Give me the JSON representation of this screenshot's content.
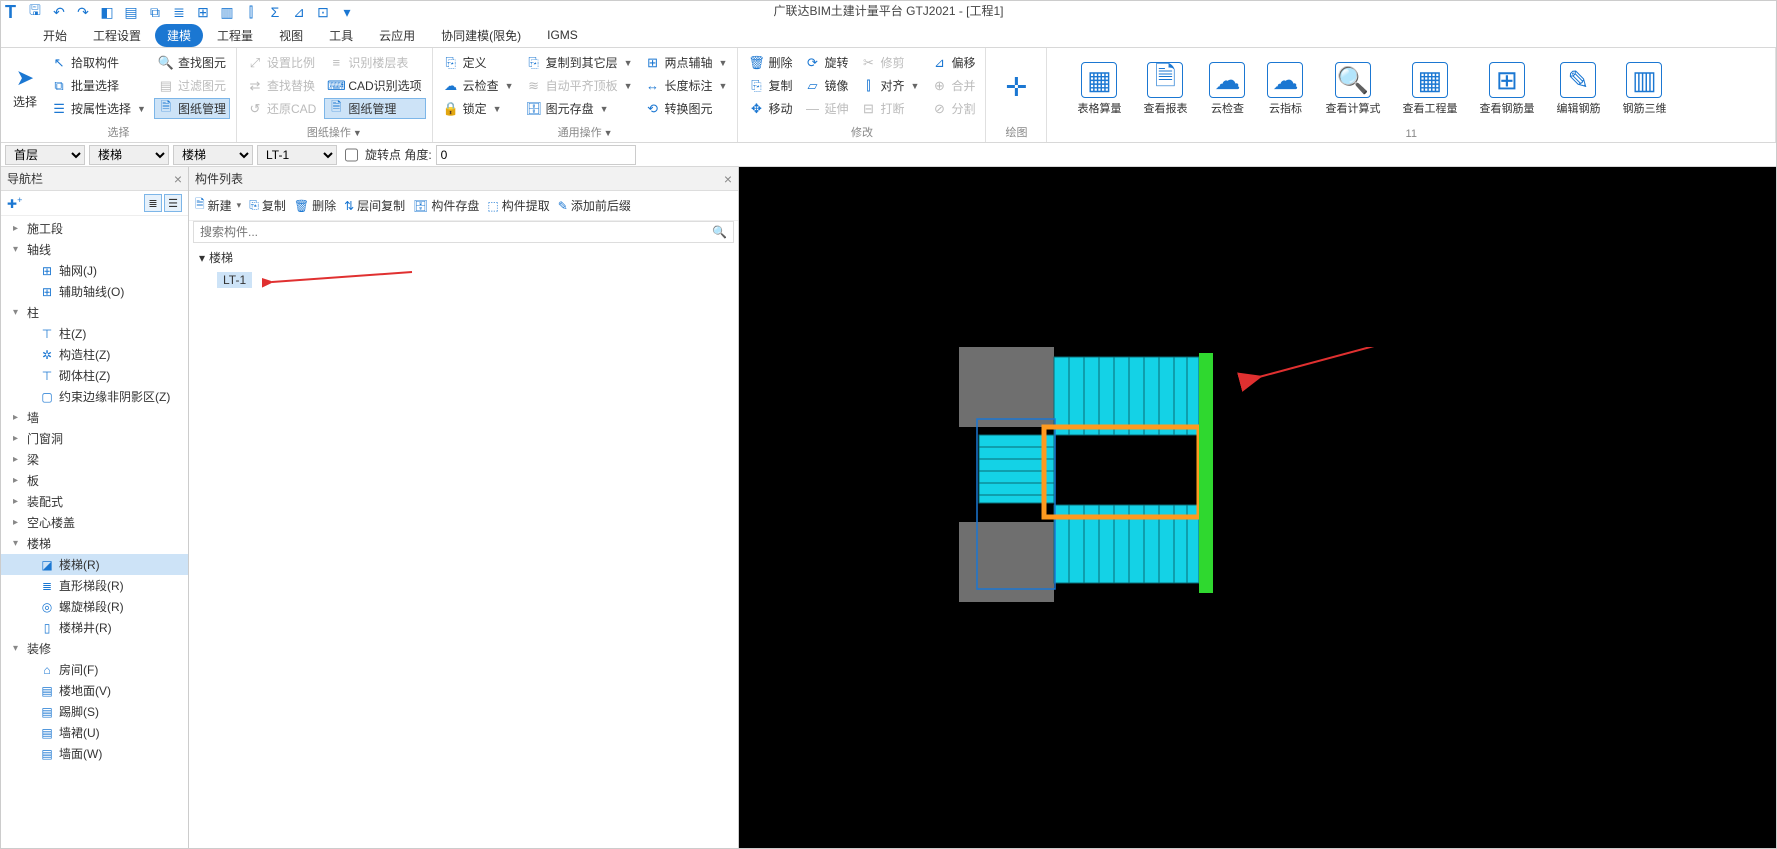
{
  "app_title": "广联达BIM土建计量平台 GTJ2021 - [工程1]",
  "menubar": {
    "items": [
      "开始",
      "工程设置",
      "建模",
      "工程量",
      "视图",
      "工具",
      "云应用",
      "协同建模(限免)",
      "IGMS"
    ],
    "active_index": 2
  },
  "ribbon": {
    "select": {
      "label": "选择",
      "arrow_name": "cursor-icon",
      "btns": [
        {
          "icon": "↖",
          "text": "拾取构件"
        },
        {
          "icon": "⧉",
          "text": "批量选择"
        },
        {
          "icon": "☰",
          "text": "按属性选择",
          "caret": true
        }
      ],
      "btns2": [
        {
          "icon": "🔍",
          "text": "查找图元"
        },
        {
          "icon": "▤",
          "text": "过滤图元",
          "disabled": true
        },
        {
          "icon": "🗎",
          "text": "图纸管理",
          "pressed": true
        }
      ]
    },
    "paper": {
      "label": "图纸操作",
      "caret": true,
      "col1": [
        {
          "icon": "⤢",
          "text": "设置比例",
          "disabled": true
        },
        {
          "icon": "⇄",
          "text": "查找替换",
          "disabled": true
        },
        {
          "icon": "↺",
          "text": "还原CAD",
          "disabled": true
        }
      ],
      "col2": [
        {
          "icon": "≡",
          "text": "识别楼层表",
          "disabled": true
        },
        {
          "icon": "⌨",
          "text": "CAD识别选项"
        },
        {
          "icon": "🗎",
          "text": "图纸管理",
          "pressed": true
        }
      ]
    },
    "general": {
      "label": "通用操作",
      "caret": true,
      "col1": [
        {
          "icon": "⎘",
          "text": "定义"
        },
        {
          "icon": "☁",
          "text": "云检查",
          "caret": true
        },
        {
          "icon": "🔒",
          "text": "锁定",
          "caret": true
        }
      ],
      "col2": [
        {
          "icon": "⎘",
          "text": "复制到其它层",
          "caret": true
        },
        {
          "icon": "≋",
          "text": "自动平齐顶板",
          "caret": true,
          "disabled": true
        },
        {
          "icon": "🗄",
          "text": "图元存盘",
          "caret": true
        }
      ],
      "col3": [
        {
          "icon": "⊞",
          "text": "两点辅轴",
          "caret": true
        },
        {
          "icon": "↔",
          "text": "长度标注",
          "caret": true
        },
        {
          "icon": "⟲",
          "text": "转换图元"
        }
      ]
    },
    "modify": {
      "label": "修改",
      "col1": [
        {
          "icon": "🗑",
          "text": "删除"
        },
        {
          "icon": "⎘",
          "text": "复制"
        },
        {
          "icon": "✥",
          "text": "移动"
        }
      ],
      "col2": [
        {
          "icon": "⟳",
          "text": "旋转"
        },
        {
          "icon": "▱",
          "text": "镜像"
        },
        {
          "icon": "—",
          "text": "延伸",
          "disabled": true
        }
      ],
      "col3": [
        {
          "icon": "✂",
          "text": "修剪",
          "disabled": true
        },
        {
          "icon": "⫿",
          "text": "对齐",
          "caret": true
        },
        {
          "icon": "⊟",
          "text": "打断",
          "disabled": true
        }
      ],
      "col4": [
        {
          "icon": "⊿",
          "text": "偏移"
        },
        {
          "icon": "⊕",
          "text": "合并",
          "disabled": true
        },
        {
          "icon": "⊘",
          "text": "分割",
          "disabled": true
        }
      ]
    },
    "draw": {
      "label": "绘图",
      "icon": "⊹",
      "name": "point-icon"
    },
    "review": {
      "label": "11",
      "items": [
        {
          "icon": "▦",
          "text": "表格算量"
        },
        {
          "icon": "🗎",
          "text": "查看报表"
        },
        {
          "icon": "☁",
          "text": "云检查"
        },
        {
          "icon": "☁",
          "text": "云指标"
        },
        {
          "icon": "🔍",
          "text": "查看计算式"
        },
        {
          "icon": "▦",
          "text": "查看工程量"
        },
        {
          "icon": "⊞",
          "text": "查看钢筋量"
        },
        {
          "icon": "✎",
          "text": "编辑钢筋"
        },
        {
          "icon": "▥",
          "text": "钢筋三维"
        }
      ]
    }
  },
  "optbar": {
    "floor": "首层",
    "cat1": "楼梯",
    "cat2": "楼梯",
    "inst": "LT-1",
    "rotcheck_label": "旋转点 角度:",
    "rotval": "0"
  },
  "nav": {
    "title": "导航栏",
    "groups": [
      {
        "label": "施工段",
        "expanded": false
      },
      {
        "label": "轴线",
        "expanded": true,
        "children": [
          {
            "icon": "⊞",
            "text": "轴网(J)"
          },
          {
            "icon": "⊞",
            "text": "辅助轴线(O)"
          }
        ]
      },
      {
        "label": "柱",
        "expanded": true,
        "children": [
          {
            "icon": "⊤",
            "text": "柱(Z)"
          },
          {
            "icon": "✲",
            "text": "构造柱(Z)"
          },
          {
            "icon": "⊤",
            "text": "砌体柱(Z)"
          },
          {
            "icon": "▢",
            "text": "约束边缘非阴影区(Z)"
          }
        ]
      },
      {
        "label": "墙",
        "expanded": false
      },
      {
        "label": "门窗洞",
        "expanded": false
      },
      {
        "label": "梁",
        "expanded": false
      },
      {
        "label": "板",
        "expanded": false
      },
      {
        "label": "装配式",
        "expanded": false
      },
      {
        "label": "空心楼盖",
        "expanded": false
      },
      {
        "label": "楼梯",
        "expanded": true,
        "children": [
          {
            "icon": "◪",
            "text": "楼梯(R)",
            "selected": true
          },
          {
            "icon": "≣",
            "text": "直形梯段(R)"
          },
          {
            "icon": "◎",
            "text": "螺旋梯段(R)"
          },
          {
            "icon": "▯",
            "text": "楼梯井(R)"
          }
        ]
      },
      {
        "label": "装修",
        "expanded": true,
        "children": [
          {
            "icon": "⌂",
            "text": "房间(F)"
          },
          {
            "icon": "▤",
            "text": "楼地面(V)"
          },
          {
            "icon": "▤",
            "text": "踢脚(S)"
          },
          {
            "icon": "▤",
            "text": "墙裙(U)"
          },
          {
            "icon": "▤",
            "text": "墙面(W)"
          }
        ]
      }
    ]
  },
  "complist": {
    "title": "构件列表",
    "toolbar": [
      {
        "icon": "🗎",
        "text": "新建",
        "caret": true
      },
      {
        "icon": "⎘",
        "text": "复制"
      },
      {
        "icon": "🗑",
        "text": "删除"
      },
      {
        "icon": "⇅",
        "text": "层间复制"
      },
      {
        "icon": "🗄",
        "text": "构件存盘"
      },
      {
        "icon": "⬚",
        "text": "构件提取"
      },
      {
        "icon": "✎",
        "text": "添加前后缀"
      }
    ],
    "search_placeholder": "搜索构件...",
    "root": "楼梯",
    "item": "LT-1"
  }
}
